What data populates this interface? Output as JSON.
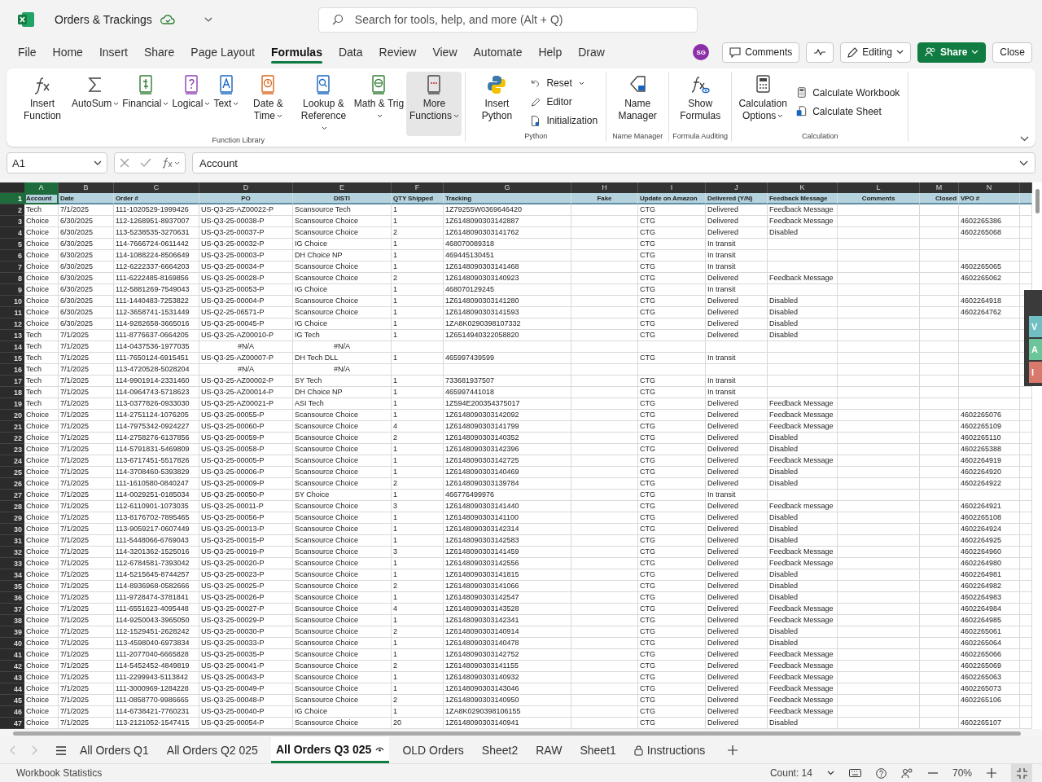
{
  "title_bar": {
    "file_name": "Orders & Trackings",
    "search": {
      "placeholder": "Search for tools, help, and more (Alt + Q)"
    }
  },
  "menu": [
    {
      "label": "File",
      "selected": false
    },
    {
      "label": "Home",
      "selected": false
    },
    {
      "label": "Insert",
      "selected": false
    },
    {
      "label": "Share",
      "selected": false
    },
    {
      "label": "Page Layout",
      "selected": false
    },
    {
      "label": "Formulas",
      "selected": true
    },
    {
      "label": "Data",
      "selected": false
    },
    {
      "label": "Review",
      "selected": false
    },
    {
      "label": "View",
      "selected": false
    },
    {
      "label": "Automate",
      "selected": false
    },
    {
      "label": "Help",
      "selected": false
    },
    {
      "label": "Draw",
      "selected": false
    }
  ],
  "toolbar": {
    "avatar": "SG",
    "comments": "Comments",
    "editing": "Editing",
    "share": "Share",
    "close": "Close"
  },
  "ribbon": [
    {
      "label": "Function Library",
      "buttons": [
        {
          "label": "Insert Function",
          "kind": "large",
          "dropdown": false,
          "hovered": false
        },
        {
          "label": "AutoSum",
          "kind": "large",
          "dropdown": true,
          "hovered": false
        },
        {
          "label": "Financial",
          "kind": "large",
          "dropdown": true,
          "hovered": false
        },
        {
          "label": "Logical",
          "kind": "large",
          "dropdown": true,
          "hovered": false
        },
        {
          "label": "Text",
          "kind": "large",
          "dropdown": true,
          "hovered": false
        },
        {
          "label": "Date & Time",
          "kind": "large",
          "dropdown": true,
          "hovered": false
        },
        {
          "label": "Lookup & Reference",
          "kind": "large",
          "dropdown": true,
          "hovered": false
        },
        {
          "label": "Math & Trig",
          "kind": "large",
          "dropdown": true,
          "hovered": false
        },
        {
          "label": "More Functions",
          "kind": "large",
          "dropdown": true,
          "hovered": true
        }
      ]
    },
    {
      "label": "Python",
      "buttons": [
        {
          "label": "Insert Python",
          "kind": "large",
          "dropdown": false,
          "hovered": false
        },
        {
          "label": "Reset",
          "kind": "small",
          "dropdown": true,
          "hovered": false
        },
        {
          "label": "Editor",
          "kind": "small",
          "dropdown": false,
          "hovered": false
        },
        {
          "label": "Initialization",
          "kind": "small",
          "dropdown": false,
          "hovered": false
        }
      ]
    },
    {
      "label": "Name Manager",
      "buttons": [
        {
          "label": "Name Manager",
          "kind": "large",
          "dropdown": false,
          "hovered": false
        }
      ]
    },
    {
      "label": "Formula Auditing",
      "buttons": [
        {
          "label": "Show Formulas",
          "kind": "large",
          "dropdown": false,
          "hovered": false
        }
      ]
    },
    {
      "label": "Calculation",
      "buttons": [
        {
          "label": "Calculation Options",
          "kind": "large",
          "dropdown": true,
          "hovered": false
        },
        {
          "label": "Calculate Workbook",
          "kind": "small",
          "dropdown": false,
          "hovered": false
        },
        {
          "label": "Calculate Sheet",
          "kind": "small",
          "dropdown": false,
          "hovered": false
        }
      ]
    }
  ],
  "formula_bar": {
    "name_box": "A1",
    "value": "Account"
  },
  "grid": {
    "columns": [
      {
        "letter": "A",
        "selected": true
      },
      {
        "letter": "B",
        "selected": false
      },
      {
        "letter": "C",
        "selected": false
      },
      {
        "letter": "D",
        "selected": false
      },
      {
        "letter": "E",
        "selected": false
      },
      {
        "letter": "F",
        "selected": false
      },
      {
        "letter": "G",
        "selected": false
      },
      {
        "letter": "H",
        "selected": false
      },
      {
        "letter": "I",
        "selected": false
      },
      {
        "letter": "J",
        "selected": false
      },
      {
        "letter": "K",
        "selected": false
      },
      {
        "letter": "L",
        "selected": false
      },
      {
        "letter": "M",
        "selected": false
      },
      {
        "letter": "N",
        "selected": false
      }
    ],
    "header_row": {
      "number": "1",
      "selected": true,
      "cells": [
        "Account",
        "Date",
        "Order #",
        "PO",
        "DISTI",
        "QTY Shipped",
        "Tracking",
        "Fake",
        "Update on Amazon",
        "Delivered (Y/N)",
        "Feedback Message",
        "Comments",
        "Closed",
        "VPO #"
      ]
    },
    "rows": [
      {
        "number": "2",
        "selected": false,
        "cells": [
          "Tech",
          "7/1/2025",
          "111-1020529-1999426",
          "US-Q3-25-AZ00022-P",
          "Scansource Tech",
          "1",
          "1Z79255W0369646420",
          "",
          "CTG",
          "Delivered",
          "Feedback Message"
        ]
      },
      {
        "number": "3",
        "selected": false,
        "cells": [
          "Choice",
          "6/30/2025",
          "112-1268951-8937007",
          "US-Q3-25-00038-P",
          "Scansource Choice",
          "1",
          "1Z6148090303142887",
          "",
          "CTG",
          "Delivered",
          "Feedback Message",
          "",
          "",
          "4602265386"
        ]
      },
      {
        "number": "4",
        "selected": false,
        "cells": [
          "Choice",
          "6/30/2025",
          "113-5238535-3270631",
          "US-Q3-25-00037-P",
          "Scansource Choice",
          "2",
          "1Z6148090303141762",
          "",
          "CTG",
          "Delivered",
          "Disabled",
          "",
          "",
          "4602265068"
        ]
      },
      {
        "number": "5",
        "selected": false,
        "cells": [
          "Choice",
          "6/30/2025",
          "114-7666724-0611442",
          "US-Q3-25-00032-P",
          "IG Choice",
          "1",
          "468070089318",
          "",
          "CTG",
          "In transit"
        ]
      },
      {
        "number": "6",
        "selected": false,
        "cells": [
          "Choice",
          "6/30/2025",
          "114-1088224-8506649",
          "US-Q3-25-00003-P",
          "DH Choice NP",
          "1",
          "469445130451",
          "",
          "CTG",
          "In transit"
        ]
      },
      {
        "number": "7",
        "selected": false,
        "cells": [
          "Choice",
          "6/30/2025",
          "112-6222337-6664203",
          "US-Q3-25-00034-P",
          "Scansource Choice",
          "1",
          "1Z6148090303141468",
          "",
          "CTG",
          "In transit",
          "",
          "",
          "",
          "4602265065"
        ]
      },
      {
        "number": "8",
        "selected": false,
        "cells": [
          "Choice",
          "6/30/2025",
          "111-6222485-8169856",
          "US-Q3-25-00028-P",
          "Scansource Choice",
          "2",
          "1Z6148090303140923",
          "",
          "CTG",
          "Delivered",
          "Feedback Message",
          "",
          "",
          "4602265062"
        ]
      },
      {
        "number": "9",
        "selected": false,
        "cells": [
          "Choice",
          "6/30/2025",
          "112-5881269-7549043",
          "US-Q3-25-00053-P",
          "IG Choice",
          "1",
          "468070129245",
          "",
          "CTG",
          "In transit"
        ]
      },
      {
        "number": "10",
        "selected": false,
        "cells": [
          "Choice",
          "6/30/2025",
          "111-1440483-7253822",
          "US-Q3-25-00004-P",
          "Scansource Choice",
          "1",
          "1Z6148090303141280",
          "",
          "CTG",
          "Delivered",
          "Disabled",
          "",
          "",
          "4602264918"
        ]
      },
      {
        "number": "11",
        "selected": false,
        "cells": [
          "Choice",
          "6/30/2025",
          "112-3658741-1531449",
          "US-Q2-25-06571-P",
          "Scansource Choice",
          "1",
          "1Z6148090303141593",
          "",
          "CTG",
          "Delivered",
          "Disabled",
          "",
          "",
          "4602264762"
        ]
      },
      {
        "number": "12",
        "selected": false,
        "cells": [
          "Choice",
          "6/30/2025",
          "114-9282658-3665016",
          "US-Q3-25-00045-P",
          "IG Choice",
          "1",
          "1ZA8K0290398107332",
          "",
          "CTG",
          "Delivered",
          "Disabled"
        ]
      },
      {
        "number": "13",
        "selected": false,
        "cells": [
          "Tech",
          "7/1/2025",
          "111-8776637-0664205",
          "US-Q3-25-AZ00010-P",
          "IG Tech",
          "1",
          "1Z6514940322058820",
          "",
          "CTG",
          "Delivered",
          "Disabled"
        ]
      },
      {
        "number": "14",
        "selected": false,
        "cells": [
          "Tech",
          "7/1/2025",
          "114-0437536-1977035",
          {
            "text": "#N/A",
            "kind": "error"
          },
          {
            "text": "#N/A",
            "kind": "error"
          }
        ]
      },
      {
        "number": "15",
        "selected": false,
        "cells": [
          "Tech",
          "7/1/2025",
          "111-7650124-6915451",
          "US-Q3-25-AZ00007-P",
          "DH Tech DLL",
          "1",
          "465997439599",
          "",
          "CTG",
          "In transit"
        ]
      },
      {
        "number": "16",
        "selected": false,
        "cells": [
          "Tech",
          "7/1/2025",
          "113-4720528-5028204",
          {
            "text": "#N/A",
            "kind": "error"
          },
          {
            "text": "#N/A",
            "kind": "error"
          }
        ]
      },
      {
        "number": "17",
        "selected": false,
        "cells": [
          "Tech",
          "7/1/2025",
          "114-9901914-2331460",
          "US-Q3-25-AZ00002-P",
          "SY Tech",
          "1",
          "733681937507",
          "",
          "CTG",
          "In transit"
        ]
      },
      {
        "number": "18",
        "selected": false,
        "cells": [
          "Tech",
          "7/1/2025",
          "114-0964743-5718623",
          "US-Q3-25-AZ00014-P",
          "DH Choice NP",
          "1",
          "465997441018",
          "",
          "CTG",
          "In transit"
        ]
      },
      {
        "number": "19",
        "selected": false,
        "cells": [
          "Tech",
          "7/1/2025",
          "113-0377826-0933030",
          "US-Q3-25-AZ00021-P",
          "ASI Tech",
          "1",
          "1Z594E200354375017",
          "",
          "CTG",
          "Delivered",
          "Feedback Message"
        ]
      },
      {
        "number": "20",
        "selected": false,
        "cells": [
          "Choice",
          "7/1/2025",
          "114-2751124-1076205",
          "US-Q3-25-00055-P",
          "Scansource Choice",
          "1",
          "1Z6148090303142092",
          "",
          "CTG",
          "Delivered",
          "Feedback Message",
          "",
          "",
          "4602265076"
        ]
      },
      {
        "number": "21",
        "selected": false,
        "cells": [
          "Choice",
          "7/1/2025",
          "114-7975342-0924227",
          "US-Q3-25-00060-P",
          "Scansource Choice",
          "4",
          "1Z6148090303141799",
          "",
          "CTG",
          "Delivered",
          "Feedback Message",
          "",
          "",
          "4602265109"
        ]
      },
      {
        "number": "22",
        "selected": false,
        "cells": [
          "Choice",
          "7/1/2025",
          "114-2758276-6137856",
          "US-Q3-25-00059-P",
          "Scansource Choice",
          "2",
          "1Z6148090303140352",
          "",
          "CTG",
          "Delivered",
          "Disabled",
          "",
          "",
          "4602265110"
        ]
      },
      {
        "number": "23",
        "selected": false,
        "cells": [
          "Choice",
          "7/1/2025",
          "114-5791831-5469809",
          "US-Q3-25-00058-P",
          "Scansource Choice",
          "1",
          "1Z6148090303142396",
          "",
          "CTG",
          "Delivered",
          "Disabled",
          "",
          "",
          "4602265388"
        ]
      },
      {
        "number": "24",
        "selected": false,
        "cells": [
          "Choice",
          "7/1/2025",
          "113-6717451-5517826",
          "US-Q3-25-00005-P",
          "Scansource Choice",
          "1",
          "1Z6148090303142725",
          "",
          "CTG",
          "Delivered",
          "Feedback Message",
          "",
          "",
          "4602264919"
        ]
      },
      {
        "number": "25",
        "selected": false,
        "cells": [
          "Choice",
          "7/1/2025",
          "114-3708460-5393829",
          "US-Q3-25-00006-P",
          "Scansource Choice",
          "1",
          "1Z6148090303140469",
          "",
          "CTG",
          "Delivered",
          "Disabled",
          "",
          "",
          "4602264920"
        ]
      },
      {
        "number": "26",
        "selected": false,
        "cells": [
          "Choice",
          "7/1/2025",
          "111-1610580-0840247",
          "US-Q3-25-00009-P",
          "Scansource Choice",
          "2",
          "1Z6148090303139784",
          "",
          "CTG",
          "Delivered",
          "Disabled",
          "",
          "",
          "4602264922"
        ]
      },
      {
        "number": "27",
        "selected": false,
        "cells": [
          "Choice",
          "7/1/2025",
          "114-0029251-0185034",
          "US-Q3-25-00050-P",
          "SY Choice",
          "1",
          "466776499976",
          "",
          "CTG",
          "In transit"
        ]
      },
      {
        "number": "28",
        "selected": false,
        "cells": [
          "Choice",
          "7/1/2025",
          "112-6110901-1073035",
          "US-Q3-25-00011-P",
          "Scansource Choice",
          "3",
          "1Z6148090303141440",
          "",
          "CTG",
          "Delivered",
          "Feedback message",
          "",
          "",
          "4602264921"
        ]
      },
      {
        "number": "29",
        "selected": false,
        "cells": [
          "Choice",
          "7/1/2025",
          "113-8176702-7895465",
          "US-Q3-25-00056-P",
          "Scansource Choice",
          "1",
          "1Z6148090303141100",
          "",
          "CTG",
          "Delivered",
          "Disabled",
          "",
          "",
          "4602265108"
        ]
      },
      {
        "number": "30",
        "selected": false,
        "cells": [
          "Choice",
          "7/1/2025",
          "113-9059217-0607449",
          "US-Q3-25-00013-P",
          "Scansource Choice",
          "1",
          "1Z6148090303142314",
          "",
          "CTG",
          "Delivered",
          "Disabled",
          "",
          "",
          "4602264924"
        ]
      },
      {
        "number": "31",
        "selected": false,
        "cells": [
          "Choice",
          "7/1/2025",
          "111-5448066-6769043",
          "US-Q3-25-00015-P",
          "Scansource Choice",
          "1",
          "1Z6148090303142583",
          "",
          "CTG",
          "Delivered",
          "Disabled",
          "",
          "",
          "4602264925"
        ]
      },
      {
        "number": "32",
        "selected": false,
        "cells": [
          "Choice",
          "7/1/2025",
          "114-3201362-1525016",
          "US-Q3-25-00019-P",
          "Scansource Choice",
          "3",
          "1Z6148090303141459",
          "",
          "CTG",
          "Delivered",
          "Feedback Message",
          "",
          "",
          "4602264960"
        ]
      },
      {
        "number": "33",
        "selected": false,
        "cells": [
          "Choice",
          "7/1/2025",
          "112-6784581-7393042",
          "US-Q3-25-00020-P",
          "Scansource Choice",
          "1",
          "1Z6148090303142556",
          "",
          "CTG",
          "Delivered",
          "Feedback Message",
          "",
          "",
          "4602264980"
        ]
      },
      {
        "number": "34",
        "selected": false,
        "cells": [
          "Choice",
          "7/1/2025",
          "114-5215645-8744257",
          "US-Q3-25-00023-P",
          "Scansource Choice",
          "1",
          "1Z6148090303141815",
          "",
          "CTG",
          "Delivered",
          "Disabled",
          "",
          "",
          "4602264981"
        ]
      },
      {
        "number": "35",
        "selected": false,
        "cells": [
          "Choice",
          "7/1/2025",
          "114-8936968-0582666",
          "US-Q3-25-00025-P",
          "Scansource Choice",
          "2",
          "1Z6148090303141066",
          "",
          "CTG",
          "Delivered",
          "Disabled",
          "",
          "",
          "4602264982"
        ]
      },
      {
        "number": "36",
        "selected": false,
        "cells": [
          "Choice",
          "7/1/2025",
          "111-9728474-3781841",
          "US-Q3-25-00026-P",
          "Scansource Choice",
          "1",
          "1Z6148090303142547",
          "",
          "CTG",
          "Delivered",
          "Disabled",
          "",
          "",
          "4602264983"
        ]
      },
      {
        "number": "37",
        "selected": false,
        "cells": [
          "Choice",
          "7/1/2025",
          "111-6551623-4095448",
          "US-Q3-25-00027-P",
          "Scansource Choice",
          "4",
          "1Z6148090303143528",
          "",
          "CTG",
          "Delivered",
          "Feedback Message",
          "",
          "",
          "4602264984"
        ]
      },
      {
        "number": "38",
        "selected": false,
        "cells": [
          "Choice",
          "7/1/2025",
          "114-9250043-3965050",
          "US-Q3-25-00029-P",
          "Scansource Choice",
          "1",
          "1Z6148090303142341",
          "",
          "CTG",
          "Delivered",
          "Feedback Message",
          "",
          "",
          "4602264985"
        ]
      },
      {
        "number": "39",
        "selected": false,
        "cells": [
          "Choice",
          "7/1/2025",
          "112-1529451-2628242",
          "US-Q3-25-00030-P",
          "Scansource Choice",
          "2",
          "1Z6148090303140914",
          "",
          "CTG",
          "Delivered",
          "Disabled",
          "",
          "",
          "4602265061"
        ]
      },
      {
        "number": "40",
        "selected": false,
        "cells": [
          "Choice",
          "7/1/2025",
          "113-4598040-6973834",
          "US-Q3-25-00033-P",
          "Scansource Choice",
          "1",
          "1Z6148090303140478",
          "",
          "CTG",
          "Delivered",
          "Disabled",
          "",
          "",
          "4602265064"
        ]
      },
      {
        "number": "41",
        "selected": false,
        "cells": [
          "Choice",
          "7/1/2025",
          "111-2077040-6665828",
          "US-Q3-25-00035-P",
          "Scansource Choice",
          "1",
          "1Z6148090303142752",
          "",
          "CTG",
          "Delivered",
          "Feedback Message",
          "",
          "",
          "4602265066"
        ]
      },
      {
        "number": "42",
        "selected": false,
        "cells": [
          "Choice",
          "7/1/2025",
          "114-5452452-4849819",
          "US-Q3-25-00041-P",
          "Scansource Choice",
          "2",
          "1Z6148090303141155",
          "",
          "CTG",
          "Delivered",
          "Feedback Message",
          "",
          "",
          "4602265069"
        ]
      },
      {
        "number": "43",
        "selected": false,
        "cells": [
          "Choice",
          "7/1/2025",
          "111-2299943-5113842",
          "US-Q3-25-00043-P",
          "Scansource Choice",
          "1",
          "1Z6148090303140932",
          "",
          "CTG",
          "Delivered",
          "Feedback Message",
          "",
          "",
          "4602265063"
        ]
      },
      {
        "number": "44",
        "selected": false,
        "cells": [
          "Choice",
          "7/1/2025",
          "111-3000969-1284228",
          "US-Q3-25-00049-P",
          "Scansource Choice",
          "1",
          "1Z6148090303143046",
          "",
          "CTG",
          "Delivered",
          "Feedback Message",
          "",
          "",
          "4602265073"
        ]
      },
      {
        "number": "45",
        "selected": false,
        "cells": [
          "Choice",
          "7/1/2025",
          "111-0858770-9986665",
          "US-Q3-25-00048-P",
          "Scansource Choice",
          "2",
          "1Z6148090303140950",
          "",
          "CTG",
          "Delivered",
          "Feedback Message",
          "",
          "",
          "4602265106"
        ]
      },
      {
        "number": "46",
        "selected": false,
        "cells": [
          "Choice",
          "7/1/2025",
          "114-6738421-7760231",
          "US-Q3-25-00040-P",
          "IG Choice",
          "1",
          "1ZA8K0290398106155",
          "",
          "CTG",
          "Delivered",
          "Feedback Message"
        ]
      },
      {
        "number": "47",
        "selected": false,
        "cells": [
          "Choice",
          "7/1/2025",
          "113-2121052-1547415",
          "US-Q3-25-00054-P",
          "Scansource Choice",
          "20",
          "1Z6148090303140941",
          "",
          "CTG",
          "Delivered",
          "Disabled",
          "",
          "",
          "4602265107"
        ]
      }
    ]
  },
  "side_panel": [
    {
      "label": "V",
      "color": "#6fbfc4"
    },
    {
      "label": "A",
      "color": "#6cc49a"
    },
    {
      "label": "I",
      "color": "#d9796e"
    }
  ],
  "sheet_tabs": [
    {
      "label": "All Orders Q1",
      "selected": false,
      "kind": "plain"
    },
    {
      "label": "All Orders Q2 025",
      "selected": false,
      "kind": "plain"
    },
    {
      "label": "All Orders Q3 025",
      "selected": true,
      "kind": "watched"
    },
    {
      "label": "OLD Orders",
      "selected": false,
      "kind": "plain"
    },
    {
      "label": "Sheet2",
      "selected": false,
      "kind": "plain"
    },
    {
      "label": "RAW",
      "selected": false,
      "kind": "plain"
    },
    {
      "label": "Sheet1",
      "selected": false,
      "kind": "plain"
    },
    {
      "label": "Instructions",
      "selected": false,
      "kind": "locked"
    }
  ],
  "status_bar": {
    "left": "Workbook Statistics",
    "count": "Count: 14",
    "zoom": "70%"
  }
}
